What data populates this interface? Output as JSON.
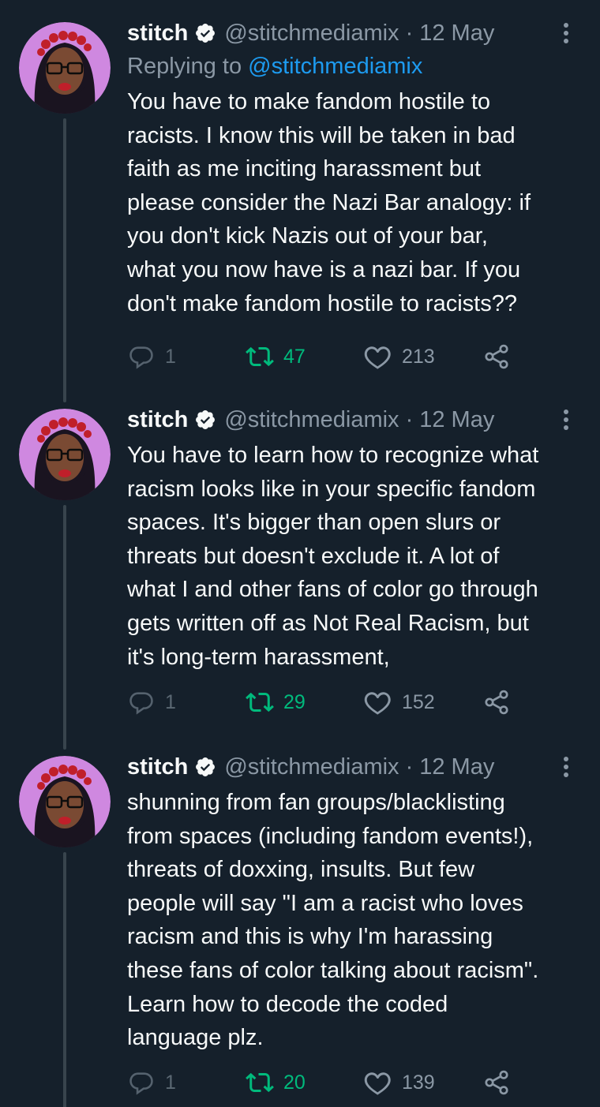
{
  "tweets": [
    {
      "name": "stitch",
      "handle": "@stitchmediamix",
      "separator": "·",
      "time": "12 May",
      "replying_to_prefix": "Replying to ",
      "replying_to_handle": "@stitchmediamix",
      "text": "You have to make fandom hostile to\nracists. I know this will be taken in bad\nfaith as me inciting harassment but\nplease consider the Nazi Bar analogy: if\nyou don't kick Nazis out of your bar,\nwhat you now have is a nazi bar. If you\ndon't make fandom hostile to racists??",
      "replies": "1",
      "retweets": "47",
      "likes": "213"
    },
    {
      "name": "stitch",
      "handle": "@stitchmediamix",
      "separator": "·",
      "time": "12 May",
      "text": "You have to learn how to recognize what\nracism looks like in your specific fandom\nspaces. It's bigger than open slurs or\nthreats but doesn't exclude it. A lot of\nwhat I and other fans of color go through\ngets written off as Not Real Racism, but\nit's long-term harassment,",
      "replies": "1",
      "retweets": "29",
      "likes": "152"
    },
    {
      "name": "stitch",
      "handle": "@stitchmediamix",
      "separator": "·",
      "time": "12 May",
      "text": "shunning from fan groups/blacklisting\nfrom spaces (including fandom events!),\nthreats of doxxing, insults. But few\npeople will say \"I am a racist who loves\nracism and this is why I'm harassing\nthese fans of color talking about racism\".\nLearn how to decode the coded\nlanguage plz.",
      "replies": "1",
      "retweets": "20",
      "likes": "139"
    }
  ],
  "colors": {
    "background": "#15202b",
    "text": "#f7f9f9",
    "secondary": "#8b98a5",
    "link": "#1d9bf0",
    "retweet": "#00ba7c",
    "verified": "#f7f9f9"
  },
  "icons": [
    "verified-badge-icon",
    "more-icon",
    "reply-icon",
    "retweet-icon",
    "like-icon",
    "share-icon"
  ]
}
